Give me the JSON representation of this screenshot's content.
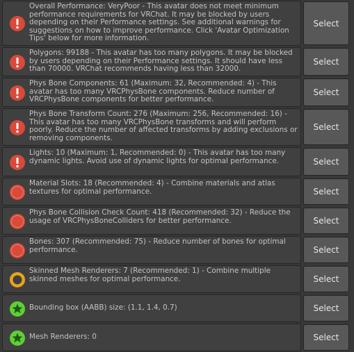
{
  "select_label": "Select",
  "colors": {
    "error": "#d84a3a",
    "warning": "#eaa419",
    "ok": "#5fcf35"
  },
  "icons": {
    "error": "error-exclamation-icon",
    "error_solid": "error-circle-icon",
    "warning": "warning-circle-icon",
    "ok": "star-icon"
  },
  "items": [
    {
      "severity": "error",
      "icon": "error",
      "text": "Overall Performance: VeryPoor - This avatar does not meet minimum performance requirements for VRChat. It may be blocked by users depending on their Performance settings. See additional warnings for suggestions on how to improve performance. Click 'Avatar Optimization Tips' below for more information."
    },
    {
      "severity": "error",
      "icon": "error",
      "text": "Polygons: 99188 - This avatar has too many polygons. It may be blocked by users depending on their Performance settings. It should have less than 70000. VRChat recommends having less than 32000."
    },
    {
      "severity": "error",
      "icon": "error",
      "text": "Phys Bone Components: 61 (Maximum: 32, Recommended: 4) - This avatar has too many VRCPhysBone components. Reduce number of VRCPhysBone components for better performance."
    },
    {
      "severity": "error",
      "icon": "error",
      "text": "Phys Bone Transform Count: 276 (Maximum: 256, Recommended: 16) - This avatar has too many VRCPhysBone transforms and will perform poorly. Reduce the number of affected transforms by adding exclusions or removing components."
    },
    {
      "severity": "error",
      "icon": "error",
      "text": "Lights: 10 (Maximum: 1, Recommended: 0) - This avatar has too many dynamic lights. Avoid use of dynamic lights for optimal performance."
    },
    {
      "severity": "error",
      "icon": "error_solid",
      "text": "Material Slots: 18 (Recommended: 4) - Combine materials and atlas textures for optimal performance."
    },
    {
      "severity": "error",
      "icon": "error_solid",
      "text": "Phys Bone Collision Check Count: 418 (Recommended: 32) - Reduce the usage of VRCPhysBoneColliders for better performance."
    },
    {
      "severity": "error",
      "icon": "error_solid",
      "text": "Bones: 307 (Recommended: 75) - Reduce number of bones for optimal performance."
    },
    {
      "severity": "warning",
      "icon": "warning",
      "text": "Skinned Mesh Renderers: 7 (Recommended: 1) - Combine multiple skinned meshes for optimal performance."
    },
    {
      "severity": "ok",
      "icon": "ok",
      "text": "Bounding box (AABB) size: (1.1, 1.4, 0.7)"
    },
    {
      "severity": "ok",
      "icon": "ok",
      "text": "Mesh Renderers: 0"
    }
  ]
}
